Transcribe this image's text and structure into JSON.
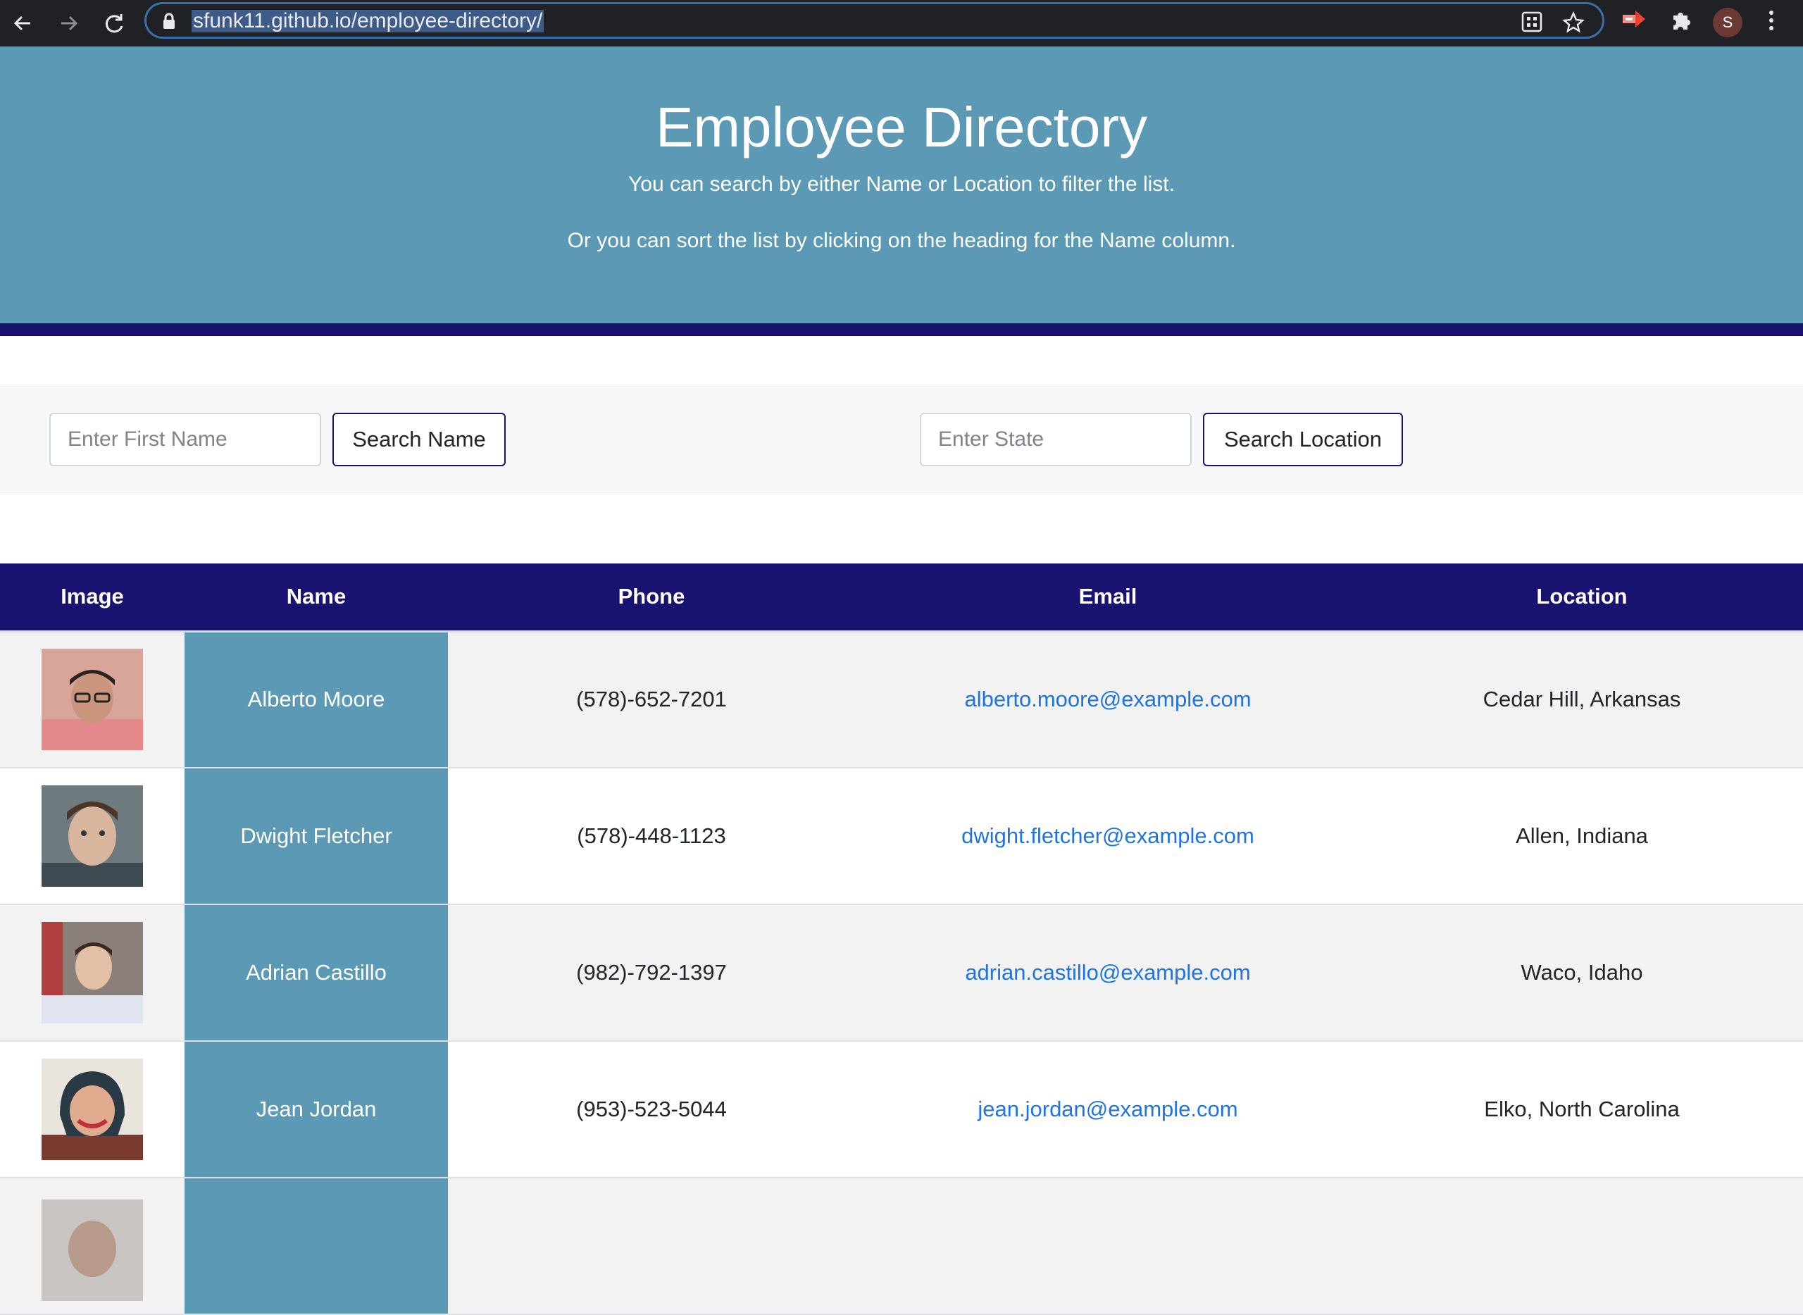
{
  "browser": {
    "url": "sfunk11.github.io/employee-directory/",
    "profile_initial": "S"
  },
  "header": {
    "title": "Employee Directory",
    "line1": "You can search by either Name or Location to filter the list.",
    "line2": "Or you can sort the list by clicking on the heading for the Name column."
  },
  "search": {
    "name_placeholder": "Enter First Name",
    "name_button": "Search Name",
    "state_placeholder": "Enter State",
    "location_button": "Search Location"
  },
  "table": {
    "headers": {
      "image": "Image",
      "name": "Name",
      "phone": "Phone",
      "email": "Email",
      "location": "Location"
    },
    "rows": [
      {
        "name": "Alberto Moore",
        "phone": "(578)-652-7201",
        "email": "alberto.moore@example.com",
        "location": "Cedar Hill, Arkansas"
      },
      {
        "name": "Dwight Fletcher",
        "phone": "(578)-448-1123",
        "email": "dwight.fletcher@example.com",
        "location": "Allen, Indiana"
      },
      {
        "name": "Adrian Castillo",
        "phone": "(982)-792-1397",
        "email": "adrian.castillo@example.com",
        "location": "Waco, Idaho"
      },
      {
        "name": "Jean Jordan",
        "phone": "(953)-523-5044",
        "email": "jean.jordan@example.com",
        "location": "Elko, North Carolina"
      }
    ]
  },
  "colors": {
    "hero": "#5b99b4",
    "navy": "#1a1270",
    "link": "#1f74df"
  }
}
